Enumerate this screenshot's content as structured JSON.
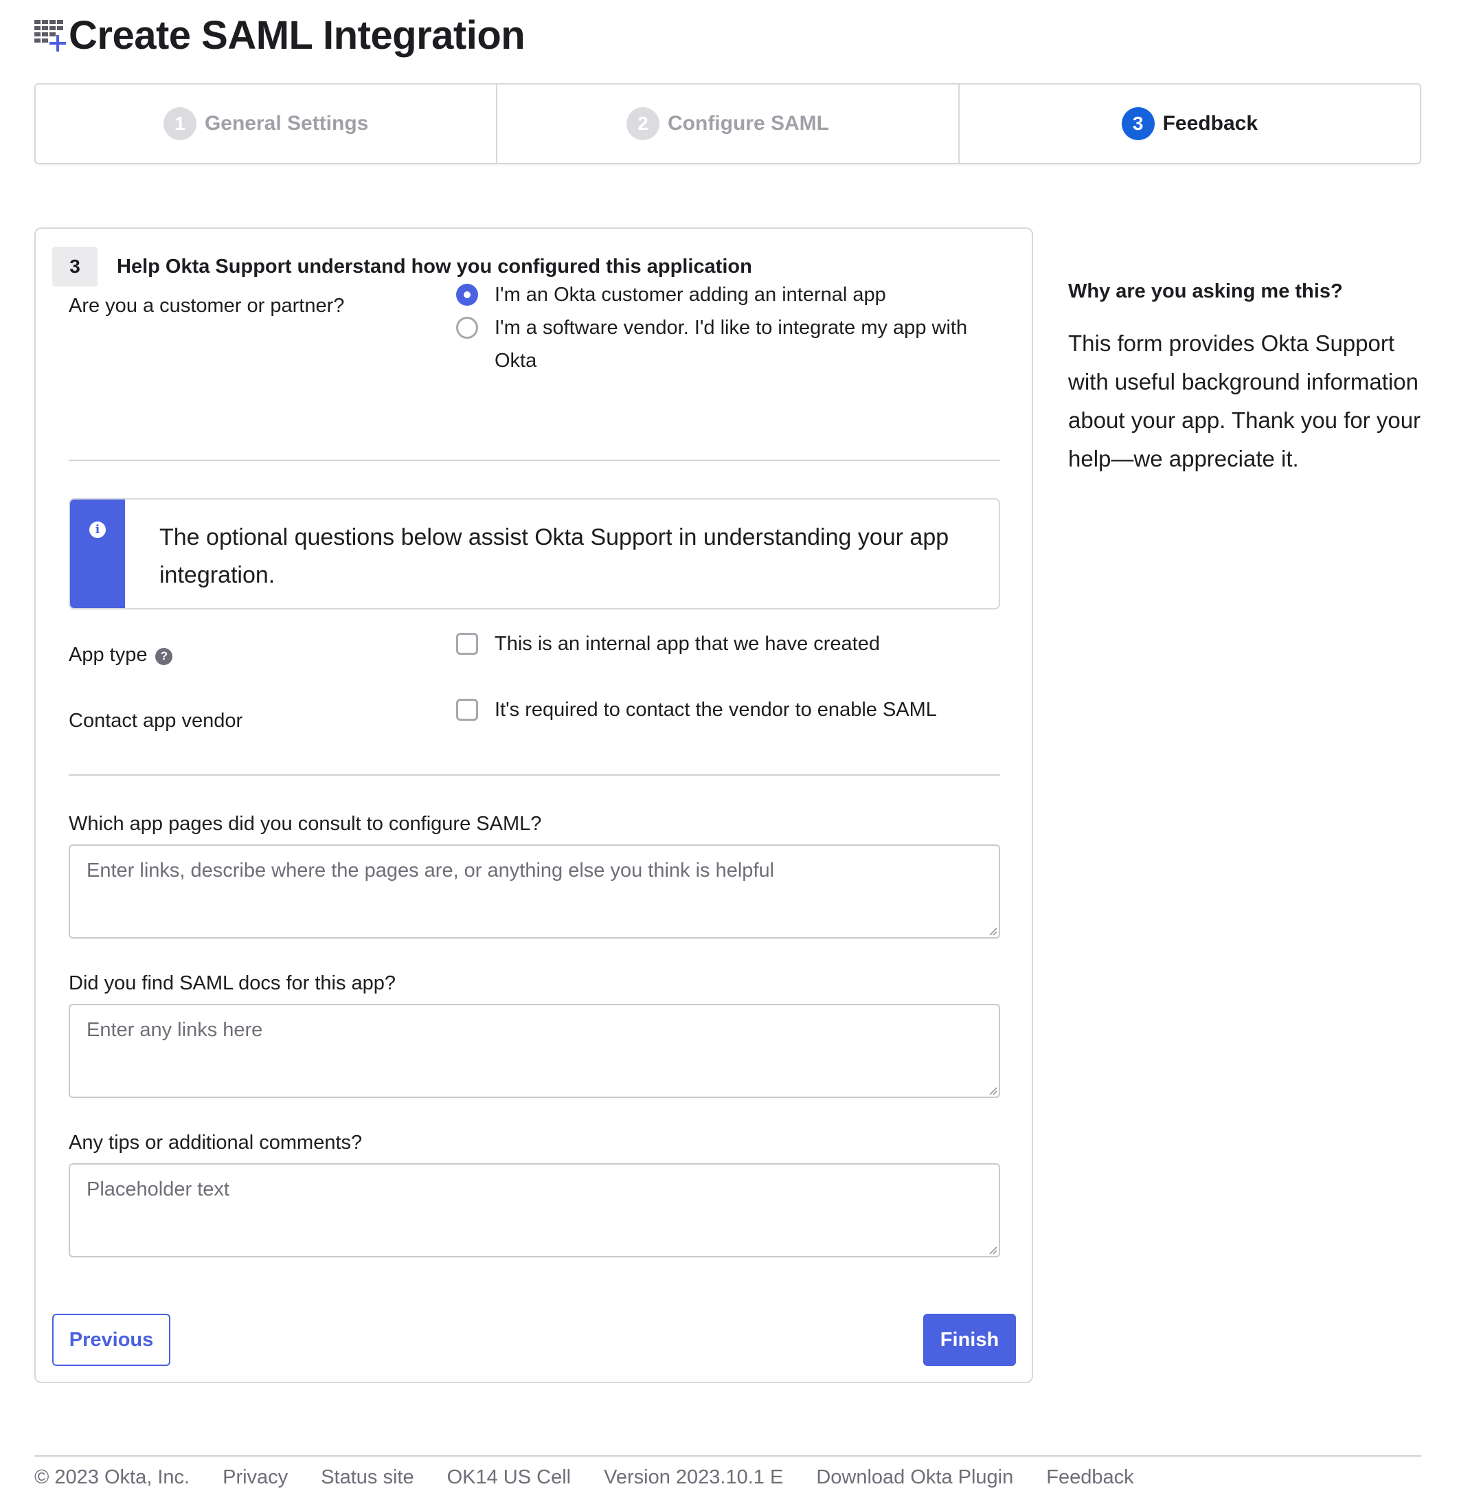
{
  "page": {
    "title": "Create SAML Integration",
    "title_icon": "app-add-icon"
  },
  "stepper": {
    "steps": [
      {
        "num": "1",
        "label": "General Settings",
        "state": "complete"
      },
      {
        "num": "2",
        "label": "Configure SAML",
        "state": "complete"
      },
      {
        "num": "3",
        "label": "Feedback",
        "state": "active"
      }
    ]
  },
  "card": {
    "step_num": "3",
    "title": "Help Okta Support understand how you configured this application",
    "customer_question": "Are you a customer or partner?",
    "customer_options": [
      {
        "label": "I'm an Okta customer adding an internal app",
        "checked": true
      },
      {
        "label": "I'm a software vendor. I'd like to integrate my app with Okta",
        "checked": false
      }
    ],
    "callout_text": "The optional questions below assist Okta Support in understanding your app integration.",
    "app_type_label": "App type",
    "app_type_option": "This is an internal app that we have created",
    "contact_label": "Contact app vendor",
    "contact_option": "It's required to contact the vendor to enable SAML",
    "q1_label": "Which app pages did you consult to configure SAML?",
    "q1_placeholder": "Enter links, describe where the pages are, or anything else you think is helpful",
    "q2_label": "Did you find SAML docs for this app?",
    "q2_placeholder": "Enter any links here",
    "q3_label": "Any tips or additional comments?",
    "q3_placeholder": "Placeholder text",
    "previous_label": "Previous",
    "finish_label": "Finish"
  },
  "sidebar": {
    "title": "Why are you asking me this?",
    "body": "This form provides Okta Support with useful background information about your app. Thank you for your help—we appreciate it."
  },
  "footer": {
    "items": [
      "© 2023 Okta, Inc.",
      "Privacy",
      "Status site",
      "OK14 US Cell",
      "Version 2023.10.1 E",
      "Download Okta Plugin",
      "Feedback"
    ]
  },
  "colors": {
    "accent": "#4a61e0",
    "step_active": "#1662dd",
    "border": "#d7d7dc",
    "muted_text": "#6e6e78"
  }
}
